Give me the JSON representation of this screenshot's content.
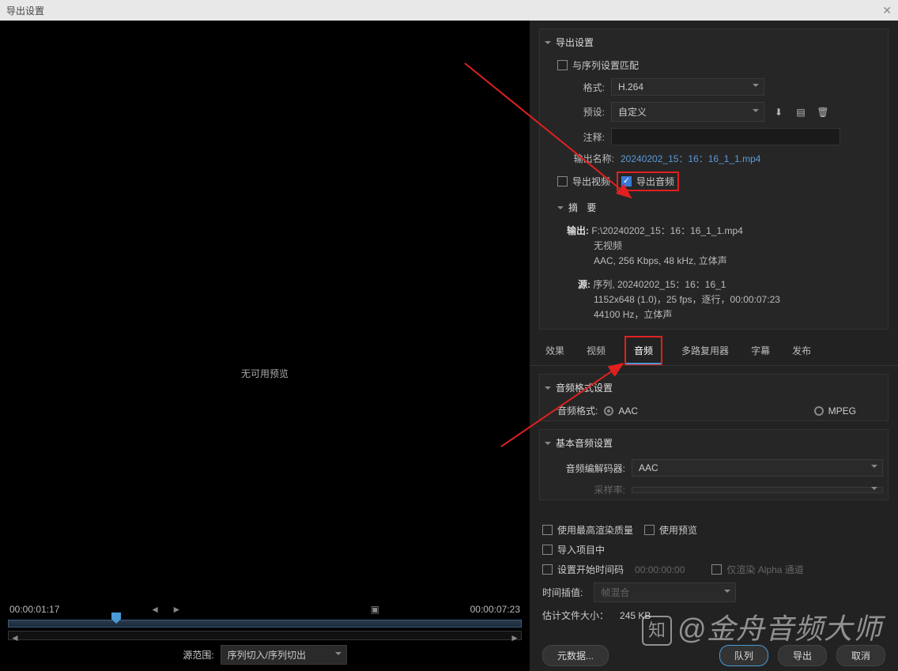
{
  "title": "导出设置",
  "preview": {
    "noPreview": "无可用预览"
  },
  "timeline": {
    "current": "00:00:01:17",
    "total": "00:00:07:23",
    "sourceRangeLabel": "源范围:",
    "sourceRangeValue": "序列切入/序列切出"
  },
  "export": {
    "header": "导出设置",
    "matchSequence": "与序列设置匹配",
    "formatLabel": "格式:",
    "formatValue": "H.264",
    "presetLabel": "预设:",
    "presetValue": "自定义",
    "commentLabel": "注释:",
    "commentValue": "",
    "outputNameLabel": "输出名称:",
    "outputNameValue": "20240202_15：16：16_1_1.mp4",
    "exportVideo": "导出视频",
    "exportAudio": "导出音频"
  },
  "summary": {
    "header": "摘 要",
    "outKey": "输出:",
    "outPath": "F:\\20240202_15：16：16_1_1.mp4",
    "outLine2": "无视频",
    "outLine3": "AAC, 256 Kbps, 48  kHz, 立体声",
    "srcKey": "源:",
    "srcLine1": "序列, 20240202_15：16：16_1",
    "srcLine2": "1152x648 (1.0)，25 fps，逐行，00:00:07:23",
    "srcLine3": "44100 Hz，立体声"
  },
  "tabs": {
    "fx": "效果",
    "video": "视频",
    "audio": "音频",
    "mux": "多路复用器",
    "caption": "字幕",
    "publish": "发布"
  },
  "audioFmt": {
    "header": "音频格式设置",
    "label": "音频格式:",
    "aac": "AAC",
    "mpeg": "MPEG"
  },
  "audioBasic": {
    "header": "基本音频设置",
    "codecLabel": "音频编解码器:",
    "codecValue": "AAC",
    "sampleLabel": "采样率:"
  },
  "bottom": {
    "maxQuality": "使用最高渲染质量",
    "usePreview": "使用预览",
    "importProj": "导入项目中",
    "setStartTC": "设置开始时间码",
    "startTCValue": "00:00:00:00",
    "alphaOnly": "仅渲染 Alpha 通道",
    "interpLabel": "时间插值:",
    "interpValue": "帧混合",
    "estSizeLabel": "估计文件大小：",
    "estSizeValue": "245 KB"
  },
  "buttons": {
    "metadata": "元数据...",
    "queue": "队列",
    "export": "导出",
    "cancel": "取消"
  },
  "watermark": "@金舟音频大师"
}
